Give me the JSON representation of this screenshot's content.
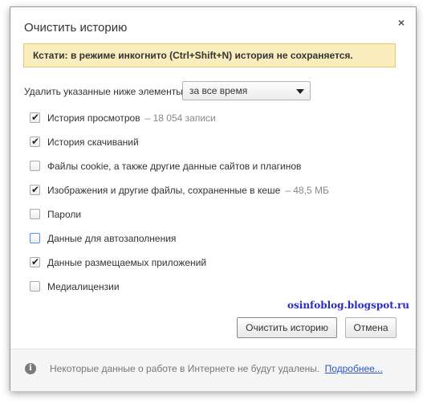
{
  "dialog": {
    "title": "Очистить историю",
    "close_glyph": "×",
    "notice": "Кстати: в режиме инкогнито (Ctrl+Shift+N) история не сохраняется.",
    "range": {
      "label": "Удалить указанные ниже элементы",
      "selected": "за все время"
    },
    "options": [
      {
        "label": "История просмотров",
        "extra": "–  18 054 записи",
        "checked": true
      },
      {
        "label": "История скачиваний",
        "extra": "",
        "checked": true
      },
      {
        "label": "Файлы cookie, а также другие данные сайтов и плагинов",
        "extra": "",
        "checked": false
      },
      {
        "label": "Изображения и другие файлы, сохраненные в кеше",
        "extra": "–  48,5 МБ",
        "checked": true
      },
      {
        "label": "Пароли",
        "extra": "",
        "checked": false
      },
      {
        "label": "Данные для автозаполнения",
        "extra": "",
        "checked": false
      },
      {
        "label": "Данные размещаемых приложений",
        "extra": "",
        "checked": true
      },
      {
        "label": "Медиалицензии",
        "extra": "",
        "checked": false
      }
    ],
    "watermark": "osinfoblog.blogspot.ru",
    "buttons": {
      "clear": "Очистить историю",
      "cancel": "Отмена"
    },
    "footer": {
      "icon_glyph": "i",
      "text": "Некоторые данные о работе в Интернете не будут удалены.",
      "link": "Подробнее..."
    }
  },
  "colors": {
    "notice_bg": "#f9edbe",
    "link": "#2a55c9",
    "watermark": "#2a2ac8"
  }
}
